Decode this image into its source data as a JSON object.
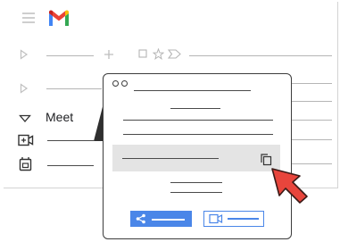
{
  "app": {
    "logo_name": "gmail-logo"
  },
  "sidebar": {
    "meet_label": "Meet",
    "icons": [
      "menu-icon",
      "expand-icon",
      "expand-icon",
      "chevron-down-icon",
      "new-meeting-icon",
      "join-meeting-icon"
    ]
  },
  "toolbar": {
    "icons": [
      "plus-icon",
      "checkbox-icon",
      "star-icon",
      "label-icon"
    ]
  },
  "popup": {
    "icons": [
      "copy-icon",
      "share-icon",
      "video-icon"
    ],
    "cursor": "pointer-cursor-icon"
  },
  "colors": {
    "accent": "#4a86e8",
    "cursor": "#e8453c",
    "link_row_bg": "#e4e4e4",
    "line": "#b5b5b5"
  }
}
